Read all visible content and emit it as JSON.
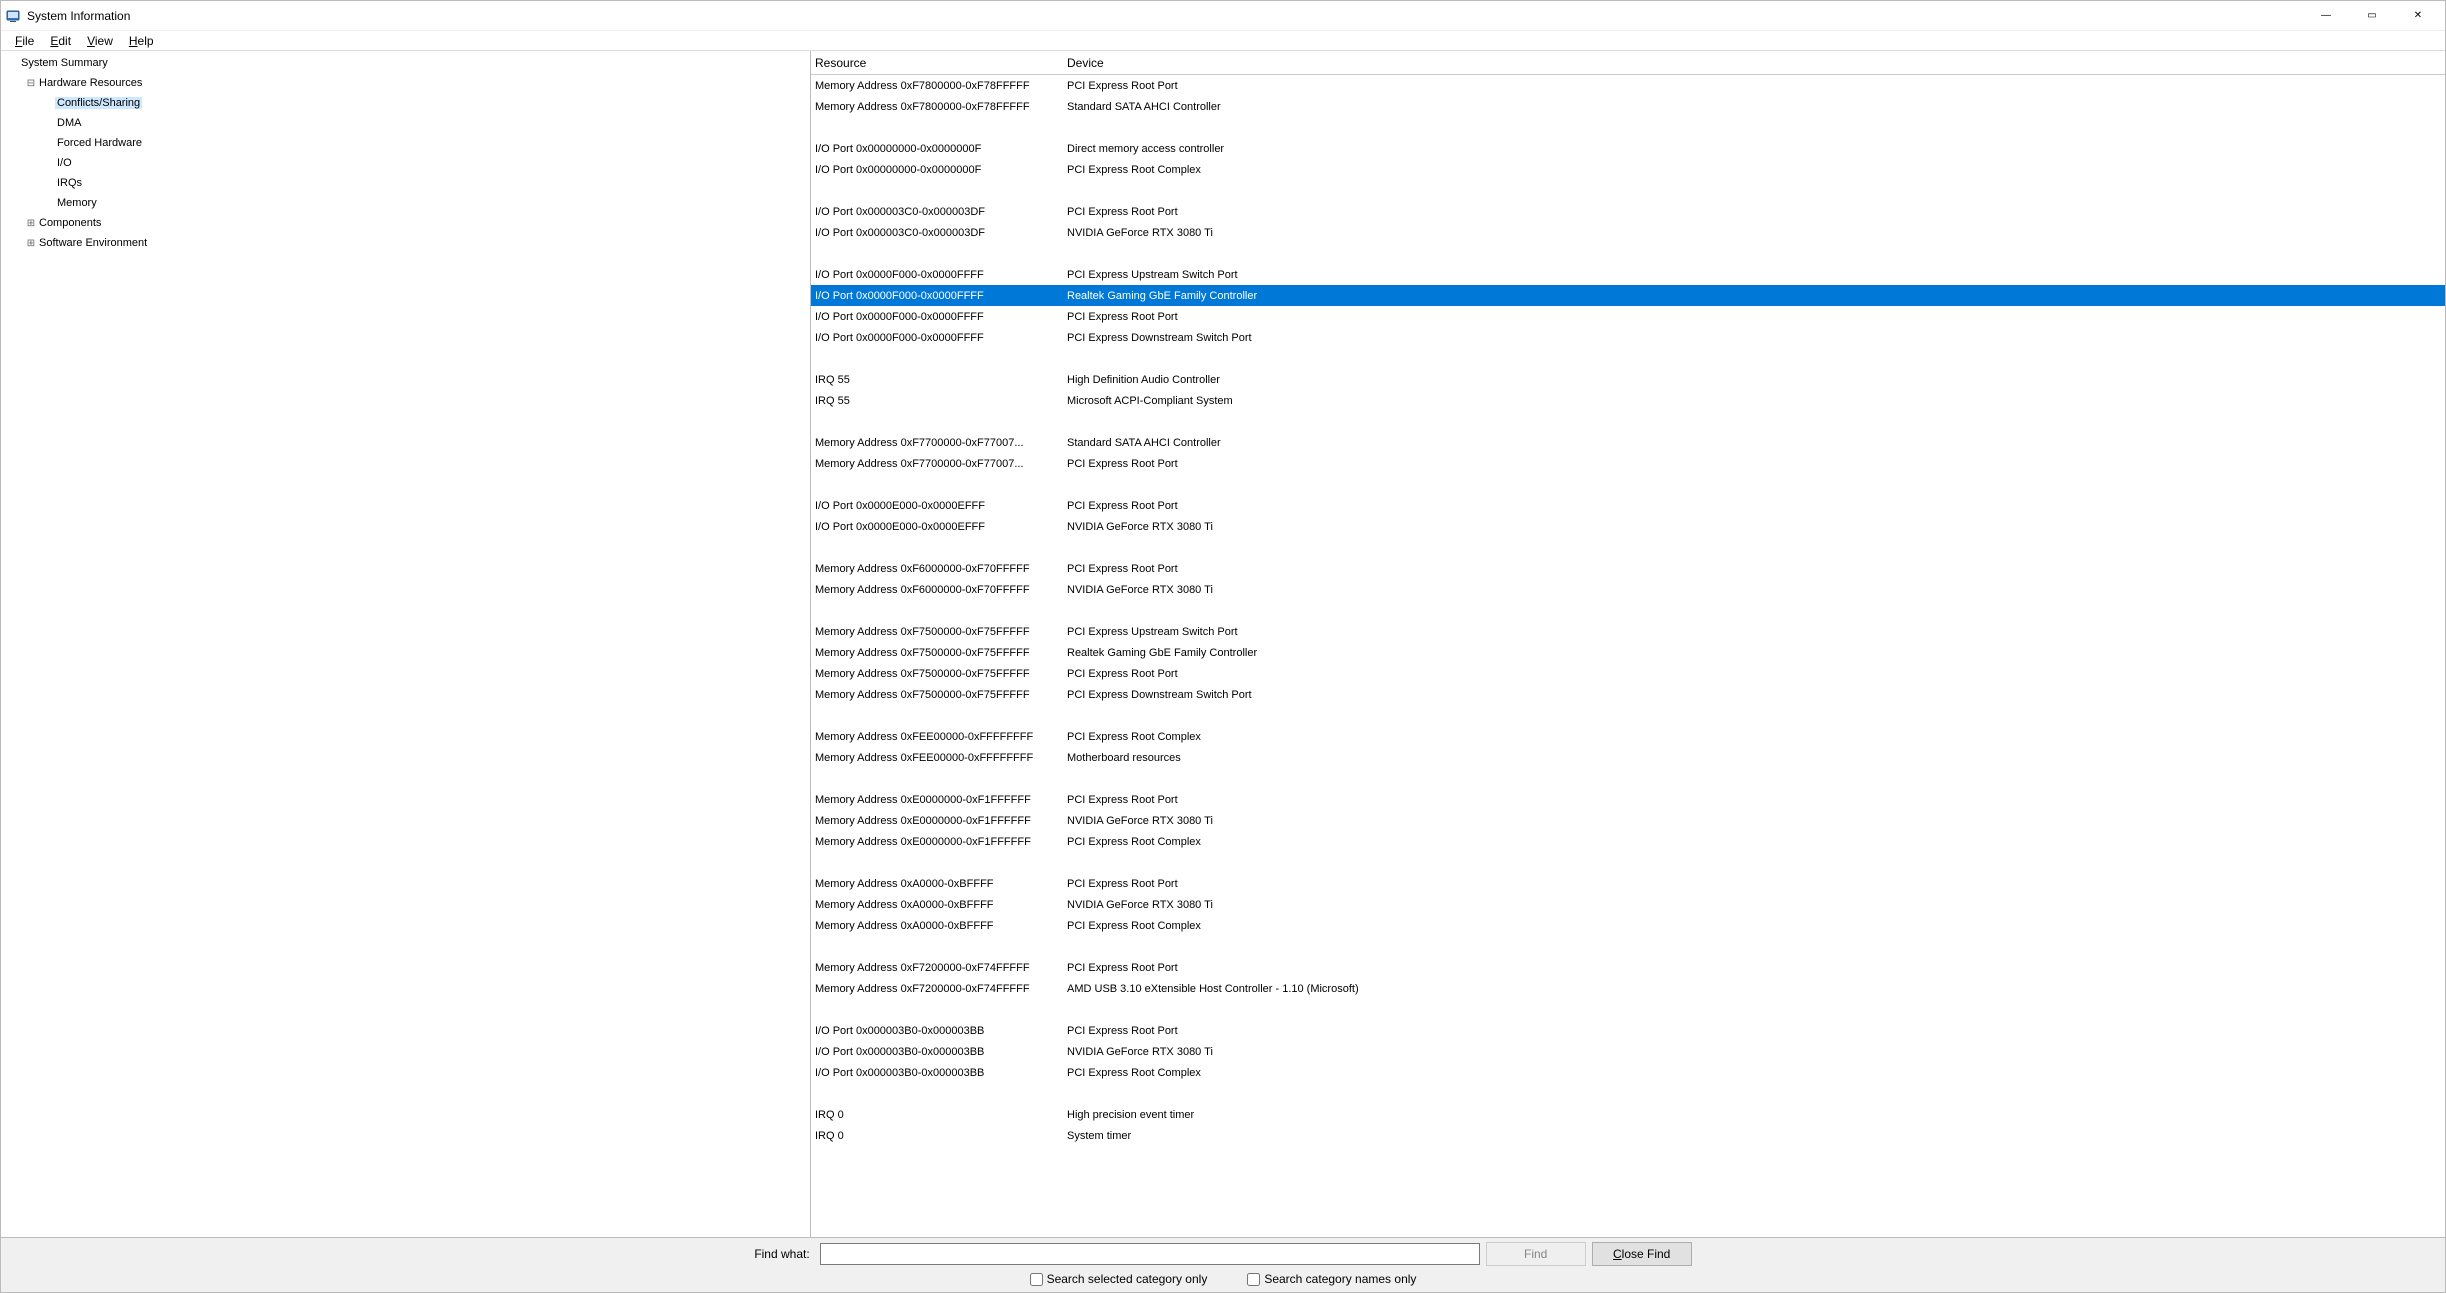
{
  "window": {
    "title": "System Information",
    "buttons": {
      "min": "—",
      "max": "▭",
      "close": "✕"
    }
  },
  "menubar": [
    {
      "label": "File",
      "accel": "F"
    },
    {
      "label": "Edit",
      "accel": "E"
    },
    {
      "label": "View",
      "accel": "V"
    },
    {
      "label": "Help",
      "accel": "H"
    }
  ],
  "tree": [
    {
      "indent": 0,
      "expander": "none",
      "label": "System Summary",
      "selected": false
    },
    {
      "indent": 1,
      "expander": "minus",
      "label": "Hardware Resources",
      "selected": false
    },
    {
      "indent": 2,
      "expander": "none",
      "label": "Conflicts/Sharing",
      "selected": true
    },
    {
      "indent": 2,
      "expander": "none",
      "label": "DMA",
      "selected": false
    },
    {
      "indent": 2,
      "expander": "none",
      "label": "Forced Hardware",
      "selected": false
    },
    {
      "indent": 2,
      "expander": "none",
      "label": "I/O",
      "selected": false
    },
    {
      "indent": 2,
      "expander": "none",
      "label": "IRQs",
      "selected": false
    },
    {
      "indent": 2,
      "expander": "none",
      "label": "Memory",
      "selected": false
    },
    {
      "indent": 1,
      "expander": "plus",
      "label": "Components",
      "selected": false
    },
    {
      "indent": 1,
      "expander": "plus",
      "label": "Software Environment",
      "selected": false
    }
  ],
  "list": {
    "columns": {
      "resource": "Resource",
      "device": "Device"
    },
    "rows": [
      {
        "r": "Memory Address 0xF7800000-0xF78FFFFF",
        "d": "PCI Express Root Port"
      },
      {
        "r": "Memory Address 0xF7800000-0xF78FFFFF",
        "d": "Standard SATA AHCI Controller"
      },
      {
        "spacer": true
      },
      {
        "r": "I/O Port 0x00000000-0x0000000F",
        "d": "Direct memory access controller"
      },
      {
        "r": "I/O Port 0x00000000-0x0000000F",
        "d": "PCI Express Root Complex"
      },
      {
        "spacer": true
      },
      {
        "r": "I/O Port 0x000003C0-0x000003DF",
        "d": "PCI Express Root Port"
      },
      {
        "r": "I/O Port 0x000003C0-0x000003DF",
        "d": "NVIDIA GeForce RTX 3080 Ti"
      },
      {
        "spacer": true
      },
      {
        "r": "I/O Port 0x0000F000-0x0000FFFF",
        "d": "PCI Express Upstream Switch Port"
      },
      {
        "r": "I/O Port 0x0000F000-0x0000FFFF",
        "d": "Realtek Gaming GbE Family Controller",
        "selected": true
      },
      {
        "r": "I/O Port 0x0000F000-0x0000FFFF",
        "d": "PCI Express Root Port"
      },
      {
        "r": "I/O Port 0x0000F000-0x0000FFFF",
        "d": "PCI Express Downstream Switch Port"
      },
      {
        "spacer": true
      },
      {
        "r": "IRQ 55",
        "d": "High Definition Audio Controller"
      },
      {
        "r": "IRQ 55",
        "d": "Microsoft ACPI-Compliant System"
      },
      {
        "spacer": true
      },
      {
        "r": "Memory Address 0xF7700000-0xF77007...",
        "d": "Standard SATA AHCI Controller"
      },
      {
        "r": "Memory Address 0xF7700000-0xF77007...",
        "d": "PCI Express Root Port"
      },
      {
        "spacer": true
      },
      {
        "r": "I/O Port 0x0000E000-0x0000EFFF",
        "d": "PCI Express Root Port"
      },
      {
        "r": "I/O Port 0x0000E000-0x0000EFFF",
        "d": "NVIDIA GeForce RTX 3080 Ti"
      },
      {
        "spacer": true
      },
      {
        "r": "Memory Address 0xF6000000-0xF70FFFFF",
        "d": "PCI Express Root Port"
      },
      {
        "r": "Memory Address 0xF6000000-0xF70FFFFF",
        "d": "NVIDIA GeForce RTX 3080 Ti"
      },
      {
        "spacer": true
      },
      {
        "r": "Memory Address 0xF7500000-0xF75FFFFF",
        "d": "PCI Express Upstream Switch Port"
      },
      {
        "r": "Memory Address 0xF7500000-0xF75FFFFF",
        "d": "Realtek Gaming GbE Family Controller"
      },
      {
        "r": "Memory Address 0xF7500000-0xF75FFFFF",
        "d": "PCI Express Root Port"
      },
      {
        "r": "Memory Address 0xF7500000-0xF75FFFFF",
        "d": "PCI Express Downstream Switch Port"
      },
      {
        "spacer": true
      },
      {
        "r": "Memory Address 0xFEE00000-0xFFFFFFFF",
        "d": "PCI Express Root Complex"
      },
      {
        "r": "Memory Address 0xFEE00000-0xFFFFFFFF",
        "d": "Motherboard resources"
      },
      {
        "spacer": true
      },
      {
        "r": "Memory Address 0xE0000000-0xF1FFFFFF",
        "d": "PCI Express Root Port"
      },
      {
        "r": "Memory Address 0xE0000000-0xF1FFFFFF",
        "d": "NVIDIA GeForce RTX 3080 Ti"
      },
      {
        "r": "Memory Address 0xE0000000-0xF1FFFFFF",
        "d": "PCI Express Root Complex"
      },
      {
        "spacer": true
      },
      {
        "r": "Memory Address 0xA0000-0xBFFFF",
        "d": "PCI Express Root Port"
      },
      {
        "r": "Memory Address 0xA0000-0xBFFFF",
        "d": "NVIDIA GeForce RTX 3080 Ti"
      },
      {
        "r": "Memory Address 0xA0000-0xBFFFF",
        "d": "PCI Express Root Complex"
      },
      {
        "spacer": true
      },
      {
        "r": "Memory Address 0xF7200000-0xF74FFFFF",
        "d": "PCI Express Root Port"
      },
      {
        "r": "Memory Address 0xF7200000-0xF74FFFFF",
        "d": "AMD USB 3.10 eXtensible Host Controller - 1.10 (Microsoft)"
      },
      {
        "spacer": true
      },
      {
        "r": "I/O Port 0x000003B0-0x000003BB",
        "d": "PCI Express Root Port"
      },
      {
        "r": "I/O Port 0x000003B0-0x000003BB",
        "d": "NVIDIA GeForce RTX 3080 Ti"
      },
      {
        "r": "I/O Port 0x000003B0-0x000003BB",
        "d": "PCI Express Root Complex"
      },
      {
        "spacer": true
      },
      {
        "r": "IRQ 0",
        "d": "High precision event timer"
      },
      {
        "r": "IRQ 0",
        "d": "System timer"
      }
    ]
  },
  "footer": {
    "find_label": "Find what:",
    "find_value": "",
    "find_btn": "Find",
    "close_find_btn": "Close Find",
    "search_selected": "Search selected category only",
    "search_names": "Search category names only"
  }
}
